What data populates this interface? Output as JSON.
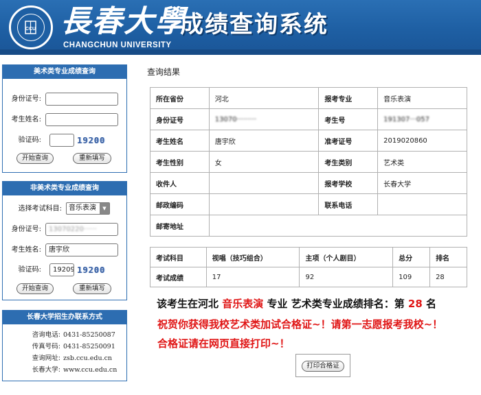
{
  "header": {
    "university_cn": "長春大學",
    "university_en": "CHANGCHUN UNIVERSITY",
    "system_title": "成绩查询系统"
  },
  "art_panel": {
    "title": "美术类专业成绩查询",
    "id_label": "身份证号:",
    "name_label": "考生姓名:",
    "captcha_label": "验证码:",
    "captcha_text": "19200",
    "query_button": "开始查询",
    "reset_button": "重新填写"
  },
  "nonart_panel": {
    "title": "非美术类专业成绩查询",
    "subject_label": "选择考试科目:",
    "subject_value": "音乐表演",
    "id_label": "身份证号:",
    "id_value": "13070220······",
    "name_label": "考生姓名:",
    "name_value": "唐宇欣",
    "captcha_label": "验证码:",
    "captcha_value": "19209",
    "captcha_text": "19200",
    "query_button": "开始查询",
    "reset_button": "重新填写"
  },
  "contact_panel": {
    "title": "长春大学招生办联系方式",
    "rows": [
      {
        "label": "咨询电话:",
        "value": "0431-85250087"
      },
      {
        "label": "传真号码:",
        "value": "0431-85250091"
      },
      {
        "label": "查询网址:",
        "value": "zsb.ccu.edu.cn"
      },
      {
        "label": "长春大学:",
        "value": "www.ccu.edu.cn"
      }
    ]
  },
  "result": {
    "heading": "查询结果",
    "info_rows": [
      [
        {
          "t": "所在省份",
          "lab": true
        },
        {
          "t": "河北"
        },
        {
          "t": "报考专业",
          "lab": true
        },
        {
          "t": "音乐表演"
        }
      ],
      [
        {
          "t": "身份证号",
          "lab": true
        },
        {
          "t": "13070·········",
          "blur": true
        },
        {
          "t": "考生号",
          "lab": true
        },
        {
          "t": "191307···057",
          "blur": true
        }
      ],
      [
        {
          "t": "考生姓名",
          "lab": true
        },
        {
          "t": "唐宇欣"
        },
        {
          "t": "准考证号",
          "lab": true
        },
        {
          "t": "2019020860"
        }
      ],
      [
        {
          "t": "考生性别",
          "lab": true
        },
        {
          "t": "女"
        },
        {
          "t": "考生类别",
          "lab": true
        },
        {
          "t": "艺术类"
        }
      ],
      [
        {
          "t": "收件人",
          "lab": true
        },
        {
          "t": ""
        },
        {
          "t": "报考学校",
          "lab": true
        },
        {
          "t": "长春大学"
        }
      ],
      [
        {
          "t": "邮政编码",
          "lab": true
        },
        {
          "t": ""
        },
        {
          "t": "联系电话",
          "lab": true
        },
        {
          "t": ""
        }
      ]
    ],
    "address_label": "邮寄地址",
    "address_value": "",
    "score_headers": [
      "考试科目",
      "视唱（技巧组合）",
      "主项（个人剧目）",
      "总分",
      "排名"
    ],
    "score_row": [
      "考试成绩",
      "17",
      "92",
      "109",
      "28"
    ],
    "rank_line": {
      "p1": "该考生在河北 ",
      "major": "音乐表演",
      "p2": " 专业 艺术类专业成绩排名：第 ",
      "rank": "28",
      "p3": " 名"
    },
    "congrats": "祝贺你获得我校艺术类加试合格证~！请第一志愿报考我校~！",
    "print_note": "合格证请在网页直接打印~！",
    "print_button": "打印合格证"
  }
}
